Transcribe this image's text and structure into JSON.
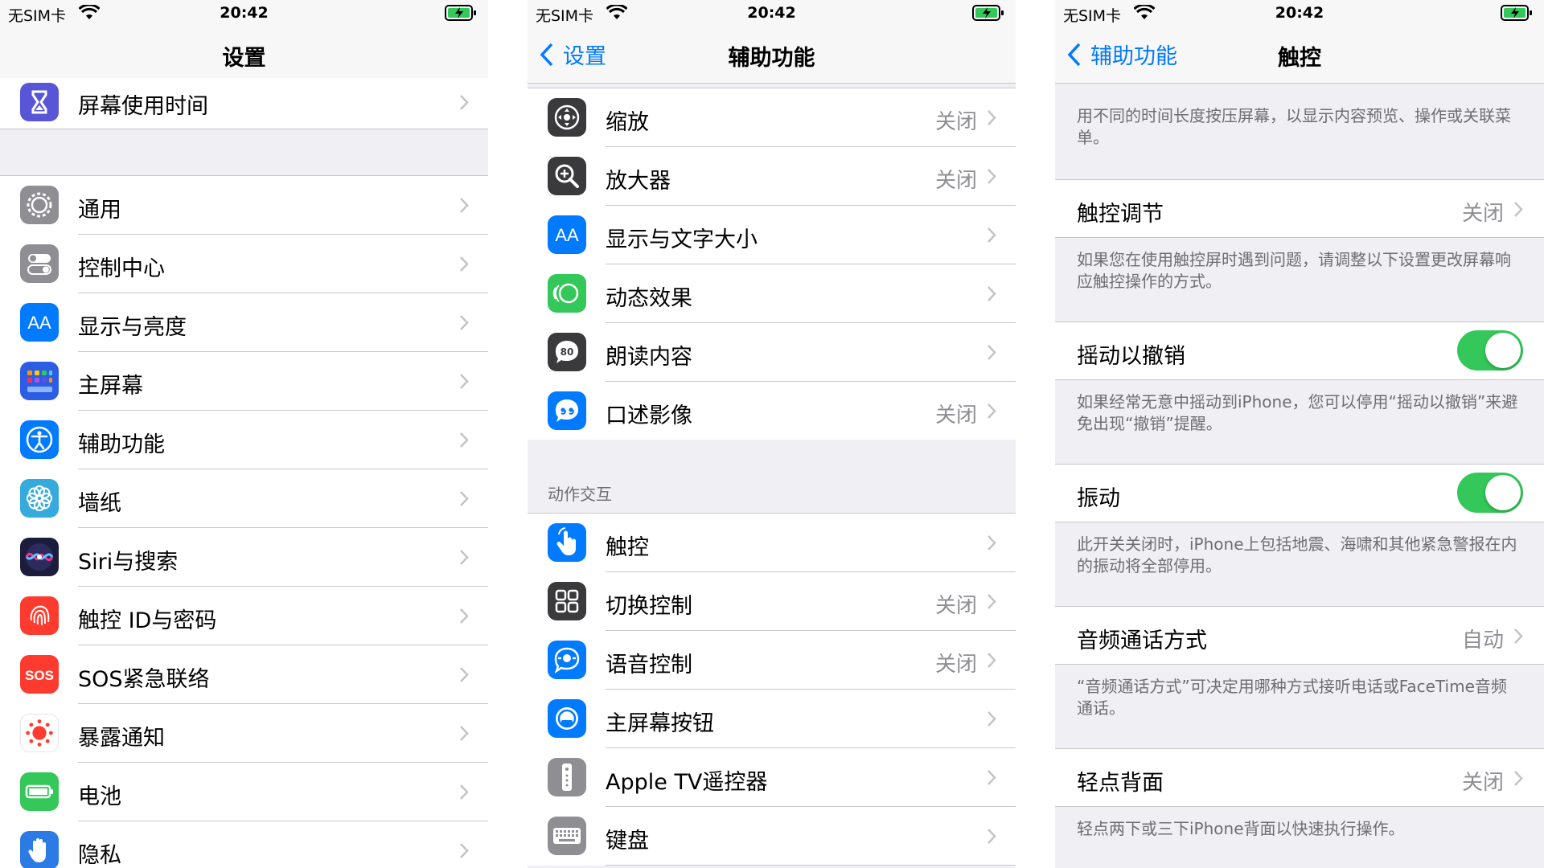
{
  "status": {
    "carrier": "无SIM卡",
    "time": "20:42"
  },
  "settings": {
    "title": "设置",
    "top_item": {
      "label": "屏幕使用时间",
      "icon": "hourglass-icon",
      "color": "#5856d6"
    },
    "items": [
      {
        "label": "通用",
        "icon": "gear-icon",
        "color": "#8e8e93"
      },
      {
        "label": "控制中心",
        "icon": "toggles-icon",
        "color": "#8e8e93"
      },
      {
        "label": "显示与亮度",
        "icon": "text-size-icon",
        "color": "#007aff"
      },
      {
        "label": "主屏幕",
        "icon": "home-grid-icon",
        "color": "#2c5de5"
      },
      {
        "label": "辅助功能",
        "icon": "accessibility-icon",
        "color": "#007aff"
      },
      {
        "label": "墙纸",
        "icon": "flower-icon",
        "color": "#35aadc"
      },
      {
        "label": "Siri与搜索",
        "icon": "siri-icon",
        "color": "#1c1c3c"
      },
      {
        "label": "触控 ID与密码",
        "icon": "fingerprint-icon",
        "color": "#ff3b30"
      },
      {
        "label": "SOS紧急联络",
        "icon": "sos-icon",
        "color": "#ff3b30",
        "glyph": "SOS"
      },
      {
        "label": "暴露通知",
        "icon": "exposure-icon",
        "color": "#ffffff"
      },
      {
        "label": "电池",
        "icon": "battery-icon",
        "color": "#34c759"
      },
      {
        "label": "隐私",
        "icon": "hand-icon",
        "color": "#2c7be5"
      }
    ]
  },
  "accessibility": {
    "back": "设置",
    "title": "辅助功能",
    "vision_items": [
      {
        "label": "缩放",
        "value": "关闭",
        "icon": "zoom-icon",
        "color": "#3a3a3c"
      },
      {
        "label": "放大器",
        "value": "关闭",
        "icon": "magnifier-icon",
        "color": "#3a3a3c"
      },
      {
        "label": "显示与文字大小",
        "value": "",
        "icon": "text-size-icon",
        "color": "#007aff"
      },
      {
        "label": "动态效果",
        "value": "",
        "icon": "motion-icon",
        "color": "#34c759"
      },
      {
        "label": "朗读内容",
        "value": "",
        "icon": "speech-icon",
        "color": "#3a3a3c"
      },
      {
        "label": "口述影像",
        "value": "关闭",
        "icon": "audio-description-icon",
        "color": "#007aff"
      }
    ],
    "section_header": "动作交互",
    "interaction_items": [
      {
        "label": "触控",
        "value": "",
        "icon": "touch-hand-icon",
        "color": "#007aff"
      },
      {
        "label": "切换控制",
        "value": "关闭",
        "icon": "switch-grid-icon",
        "color": "#3a3a3c"
      },
      {
        "label": "语音控制",
        "value": "关闭",
        "icon": "voice-control-icon",
        "color": "#007aff"
      },
      {
        "label": "主屏幕按钮",
        "value": "",
        "icon": "home-button-icon",
        "color": "#007aff"
      },
      {
        "label": "Apple TV遥控器",
        "value": "",
        "icon": "remote-icon",
        "color": "#8e8e93"
      },
      {
        "label": "键盘",
        "value": "",
        "icon": "keyboard-icon",
        "color": "#8e8e93"
      }
    ]
  },
  "touch": {
    "back": "辅助功能",
    "title": "触控",
    "intro": "用不同的时间长度按压屏幕，以显示内容预览、操作或关联菜单。",
    "rows": [
      {
        "label": "触控调节",
        "value": "关闭",
        "type": "link",
        "footer": "如果您在使用触控屏时遇到问题，请调整以下设置更改屏幕响应触控操作的方式。"
      },
      {
        "label": "摇动以撤销",
        "value": "on",
        "type": "toggle",
        "footer": "如果经常无意中摇动到iPhone，您可以停用“摇动以撤销”来避免出现“撤销”提醒。"
      },
      {
        "label": "振动",
        "value": "on",
        "type": "toggle",
        "footer": "此开关关闭时，iPhone上包括地震、海啸和其他紧急警报在内的振动将全部停用。"
      },
      {
        "label": "音频通话方式",
        "value": "自动",
        "type": "link",
        "footer": "“音频通话方式”可决定用哪种方式接听电话或FaceTime音频通话。"
      },
      {
        "label": "轻点背面",
        "value": "关闭",
        "type": "link",
        "footer": "轻点两下或三下iPhone背面以快速执行操作。"
      }
    ]
  }
}
